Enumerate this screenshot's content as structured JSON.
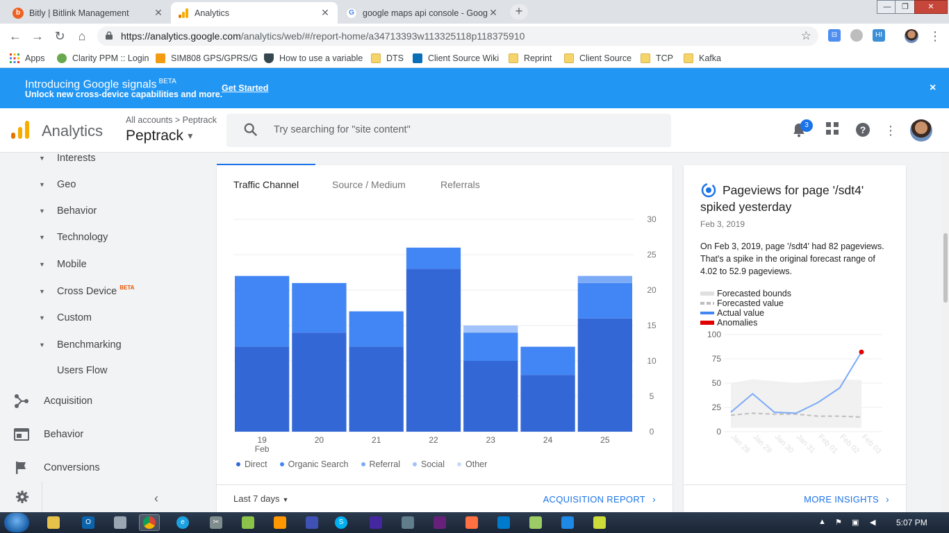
{
  "browser": {
    "tabs": [
      {
        "title": "Bitly | Bitlink Management",
        "icon": "bitly-icon",
        "active": false
      },
      {
        "title": "Analytics",
        "icon": "analytics-icon",
        "active": true
      },
      {
        "title": "google maps api console - Goog",
        "icon": "google-icon",
        "active": false
      }
    ],
    "url_host": "https://analytics.google.com",
    "url_path": "/analytics/web/#/report-home/a34713393w113325118p118375910",
    "bookmarks": [
      {
        "label": "Apps",
        "icon": "apps-grid-icon"
      },
      {
        "label": "Clarity PPM :: Login",
        "icon": "clarity-icon"
      },
      {
        "label": "SIM808 GPS/GPRS/G",
        "icon": "sim-icon"
      },
      {
        "label": "How to use a variable",
        "icon": "shield-icon"
      },
      {
        "label": "DTS",
        "icon": "folder-icon"
      },
      {
        "label": "Client Source Wiki",
        "icon": "sharepoint-icon"
      },
      {
        "label": "Reprint",
        "icon": "folder-icon"
      },
      {
        "label": "Client Source",
        "icon": "folder-icon"
      },
      {
        "label": "TCP",
        "icon": "folder-icon"
      },
      {
        "label": "Kafka",
        "icon": "folder-icon"
      }
    ]
  },
  "banner": {
    "title": "Introducing Google signals",
    "beta": "BETA",
    "subtitle": "Unlock new cross-device capabilities and more.",
    "cta": "Get Started",
    "close": "×"
  },
  "header": {
    "app_name": "Analytics",
    "breadcrumb": "All accounts > Peptrack",
    "property": "Peptrack",
    "search_placeholder": "Try searching for \"site content\"",
    "notification_count": "3"
  },
  "sidebar": {
    "sub_items": [
      {
        "label": "Interests"
      },
      {
        "label": "Geo"
      },
      {
        "label": "Behavior"
      },
      {
        "label": "Technology"
      },
      {
        "label": "Mobile"
      },
      {
        "label": "Cross Device",
        "badge": "BETA"
      },
      {
        "label": "Custom"
      },
      {
        "label": "Benchmarking"
      }
    ],
    "users_flow": "Users Flow",
    "main_items": [
      {
        "label": "Acquisition",
        "icon": "acquisition-icon"
      },
      {
        "label": "Behavior",
        "icon": "behavior-icon"
      },
      {
        "label": "Conversions",
        "icon": "flag-icon"
      }
    ]
  },
  "acquisition_card": {
    "tabs": [
      "Traffic Channel",
      "Source / Medium",
      "Referrals"
    ],
    "active_tab": "Traffic Channel",
    "date_range": "Last 7 days",
    "report_link": "ACQUISITION REPORT",
    "colors": {
      "Direct": "#3367d6",
      "Organic Search": "#4285f4",
      "Referral": "#7baaf7",
      "Social": "#a1c2fa",
      "Other": "#c6dafc"
    }
  },
  "chart_data": [
    {
      "type": "bar",
      "stacked": true,
      "categories": [
        "19 Feb",
        "20",
        "21",
        "22",
        "23",
        "24",
        "25"
      ],
      "series": [
        {
          "name": "Direct",
          "values": [
            12,
            14,
            12,
            23,
            10,
            8,
            16
          ]
        },
        {
          "name": "Organic Search",
          "values": [
            10,
            7,
            5,
            3,
            4,
            4,
            5
          ]
        },
        {
          "name": "Referral",
          "values": [
            0,
            0,
            0,
            0,
            0,
            0,
            1
          ]
        },
        {
          "name": "Social",
          "values": [
            0,
            0,
            0,
            0,
            1,
            0,
            0
          ]
        },
        {
          "name": "Other",
          "values": [
            0,
            0,
            0,
            0,
            0,
            0,
            0
          ]
        }
      ],
      "ylim": [
        0,
        30
      ],
      "yticks": [
        0,
        5,
        10,
        15,
        20,
        25,
        30
      ],
      "y_axis_side": "right",
      "grid": true,
      "legend": "bottom"
    },
    {
      "type": "line",
      "title": "Pageviews for page '/sdt4' spiked yesterday",
      "categories": [
        "Jan 28",
        "Jan 29",
        "Jan 30",
        "Jan 31",
        "Feb 01",
        "Feb 02",
        "Feb 03"
      ],
      "series": [
        {
          "name": "Forecasted bounds",
          "upper": [
            50,
            54,
            52,
            50,
            52,
            54,
            53
          ],
          "lower": [
            4,
            4,
            4,
            4,
            4,
            4,
            4
          ]
        },
        {
          "name": "Forecasted value",
          "values": [
            17,
            19,
            18,
            18,
            16,
            16,
            15
          ]
        },
        {
          "name": "Actual value",
          "values": [
            20,
            39,
            20,
            19,
            30,
            45,
            82
          ]
        },
        {
          "name": "Anomalies",
          "points": [
            {
              "x": "Feb 03",
              "y": 82
            }
          ]
        }
      ],
      "ylim": [
        0,
        100
      ],
      "yticks": [
        0,
        25,
        50,
        75,
        100
      ],
      "legend": "top-left"
    }
  ],
  "insight_card": {
    "title": "Pageviews for page '/sdt4' spiked yesterday",
    "date": "Feb 3, 2019",
    "body": "On Feb 3, 2019, page '/sdt4' had 82 pageviews. That's a spike in the original forecast range of 4.02 to 52.9 pageviews.",
    "legend": [
      {
        "label": "Forecasted bounds",
        "color": "#e0e0e0"
      },
      {
        "label": "Forecasted value",
        "color": "#bdbdbd"
      },
      {
        "label": "Actual value",
        "color": "#4285f4"
      },
      {
        "label": "Anomalies",
        "color": "#e00000"
      }
    ],
    "more_link": "MORE INSIGHTS"
  },
  "taskbar": {
    "clock": "5:07 PM"
  }
}
